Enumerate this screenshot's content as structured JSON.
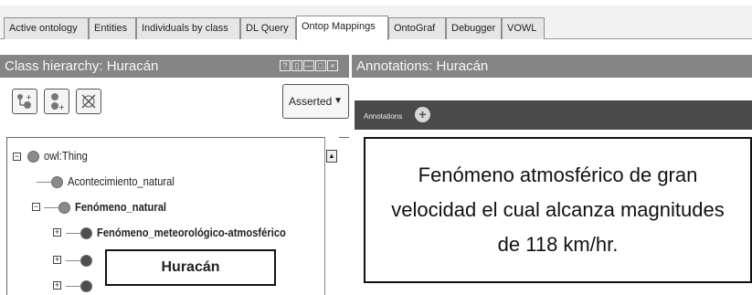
{
  "tabs": [
    {
      "label": "Active ontology"
    },
    {
      "label": "Entities"
    },
    {
      "label": "Individuals by class"
    },
    {
      "label": "DL Query"
    },
    {
      "label": "Ontop Mappings",
      "active": true
    },
    {
      "label": "OntoGraf"
    },
    {
      "label": "Debugger"
    },
    {
      "label": "VOWL"
    }
  ],
  "class_panel": {
    "title": "Class hierarchy: Huracán",
    "toolbar": [
      {
        "icon": "add-subclass-icon"
      },
      {
        "icon": "add-sibling-class-icon"
      },
      {
        "icon": "delete-class-icon"
      }
    ],
    "mode": "Asserted",
    "tree": [
      {
        "label": "owl:Thing",
        "expander": "−"
      },
      {
        "label": "Acontecimiento_natural"
      },
      {
        "label": "Fenómeno_natural",
        "expander": "−"
      },
      {
        "label": "Fenómeno_meteorológico-atmosférico",
        "expander": "+"
      },
      {
        "label": "",
        "expander": "+"
      },
      {
        "label": "",
        "expander": "+"
      }
    ],
    "selected_label": "Huracán"
  },
  "annotations_panel": {
    "title": "Annotations: Huracán",
    "section_label": "Annotations",
    "description": "Fenómeno atmosférico de gran velocidad el cual alcanza magnitudes de 118 km/hr."
  }
}
